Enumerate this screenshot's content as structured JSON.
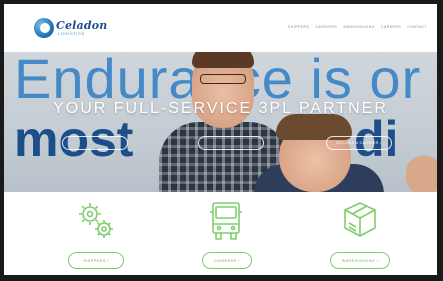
{
  "brand": {
    "name": "Celadon",
    "sub": "LOGISTICS"
  },
  "nav": [
    "SHIPPERS",
    "CARRIERS",
    "WAREHOUSING",
    "CAREERS",
    "CONTACT"
  ],
  "hero": {
    "bg_line1": "Endurance is or",
    "bg_line2": "most",
    "bg_line3": "di",
    "title": "YOUR FULL-SERVICE 3PL PARTNER",
    "buttons": [
      "",
      "",
      "BECOME A CARRIER ›"
    ]
  },
  "services": [
    {
      "icon": "gears-icon",
      "label": "SHIPPERS ›"
    },
    {
      "icon": "truck-icon",
      "label": "CARRIERS ›"
    },
    {
      "icon": "warehouse-boxes-icon",
      "label": "WAREHOUSING ›"
    }
  ],
  "colors": {
    "accent_green": "#7ecf6a",
    "brand_blue": "#1f4f8f"
  }
}
